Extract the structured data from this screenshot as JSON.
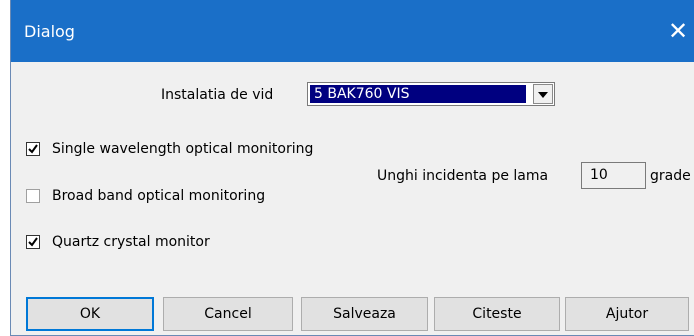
{
  "window": {
    "title": "Dialog",
    "close_glyph": "✕"
  },
  "vacuum_system": {
    "label": "Instalatia de vid",
    "selected": "5  BAK760 VIS"
  },
  "monitoring": {
    "single_wavelength": {
      "label": "Single wavelength optical monitoring",
      "checked": true
    },
    "broad_band": {
      "label": "Broad band optical monitoring",
      "checked": false
    },
    "quartz": {
      "label": "Quartz crystal monitor",
      "checked": true
    }
  },
  "incidence": {
    "label": "Unghi incidenta pe lama",
    "value": "10",
    "unit": "grade"
  },
  "buttons": {
    "ok": "OK",
    "cancel": "Cancel",
    "save": "Salveaza",
    "read": "Citeste",
    "help": "Ajutor"
  }
}
